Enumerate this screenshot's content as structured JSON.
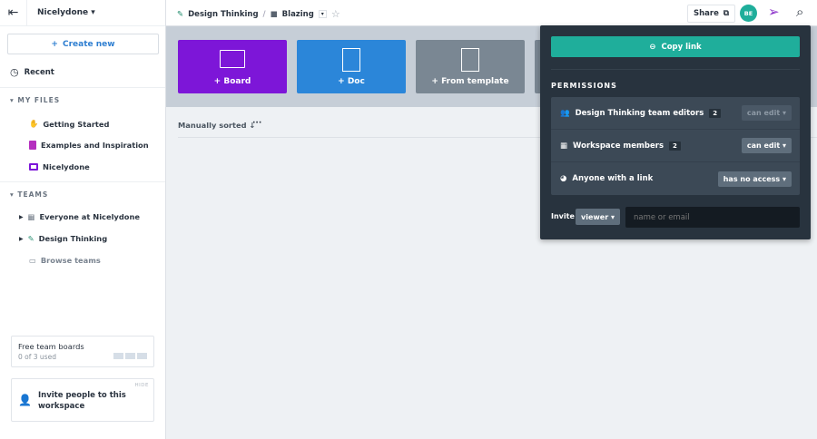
{
  "sidebar": {
    "workspace": "Nicelydone",
    "create_new": "Create new",
    "recent": "Recent",
    "my_files_label": "MY FILES",
    "my_files": [
      {
        "label": "Getting Started",
        "icon": "hand-wave-icon"
      },
      {
        "label": "Examples and Inspiration",
        "icon": "doc-stack-icon"
      },
      {
        "label": "Nicelydone",
        "icon": "board-icon"
      }
    ],
    "teams_label": "TEAMS",
    "teams": [
      {
        "label": "Everyone at Nicelydone"
      },
      {
        "label": "Design Thinking"
      }
    ],
    "browse_teams": "Browse teams",
    "free_boards": {
      "title": "Free team boards",
      "used": "0 of 3 used"
    },
    "invite_card": {
      "hide": "HIDE",
      "text": "Invite people to this workspace"
    }
  },
  "topbar": {
    "team": "Design Thinking",
    "separator": "/",
    "folder": "Blazing",
    "share": "Share",
    "avatar": "BE"
  },
  "tiles": [
    {
      "label": "+ Board",
      "color": "#7d16d8"
    },
    {
      "label": "+ Doc",
      "color": "#2b86d9"
    },
    {
      "label": "+ From template",
      "color": "#7a8793"
    }
  ],
  "sort": {
    "label": "Manually sorted ↓",
    "more": "···"
  },
  "share_popover": {
    "copy_link": "Copy link",
    "permissions_label": "PERMISSIONS",
    "rows": [
      {
        "label": "Design Thinking team editors",
        "count": "2",
        "access": "can edit"
      },
      {
        "label": "Workspace members",
        "count": "2",
        "access": "can edit"
      },
      {
        "label": "Anyone with a link",
        "access": "has no access"
      }
    ],
    "invite_label": "Invite",
    "invite_role": "viewer",
    "invite_placeholder": "name or email"
  }
}
